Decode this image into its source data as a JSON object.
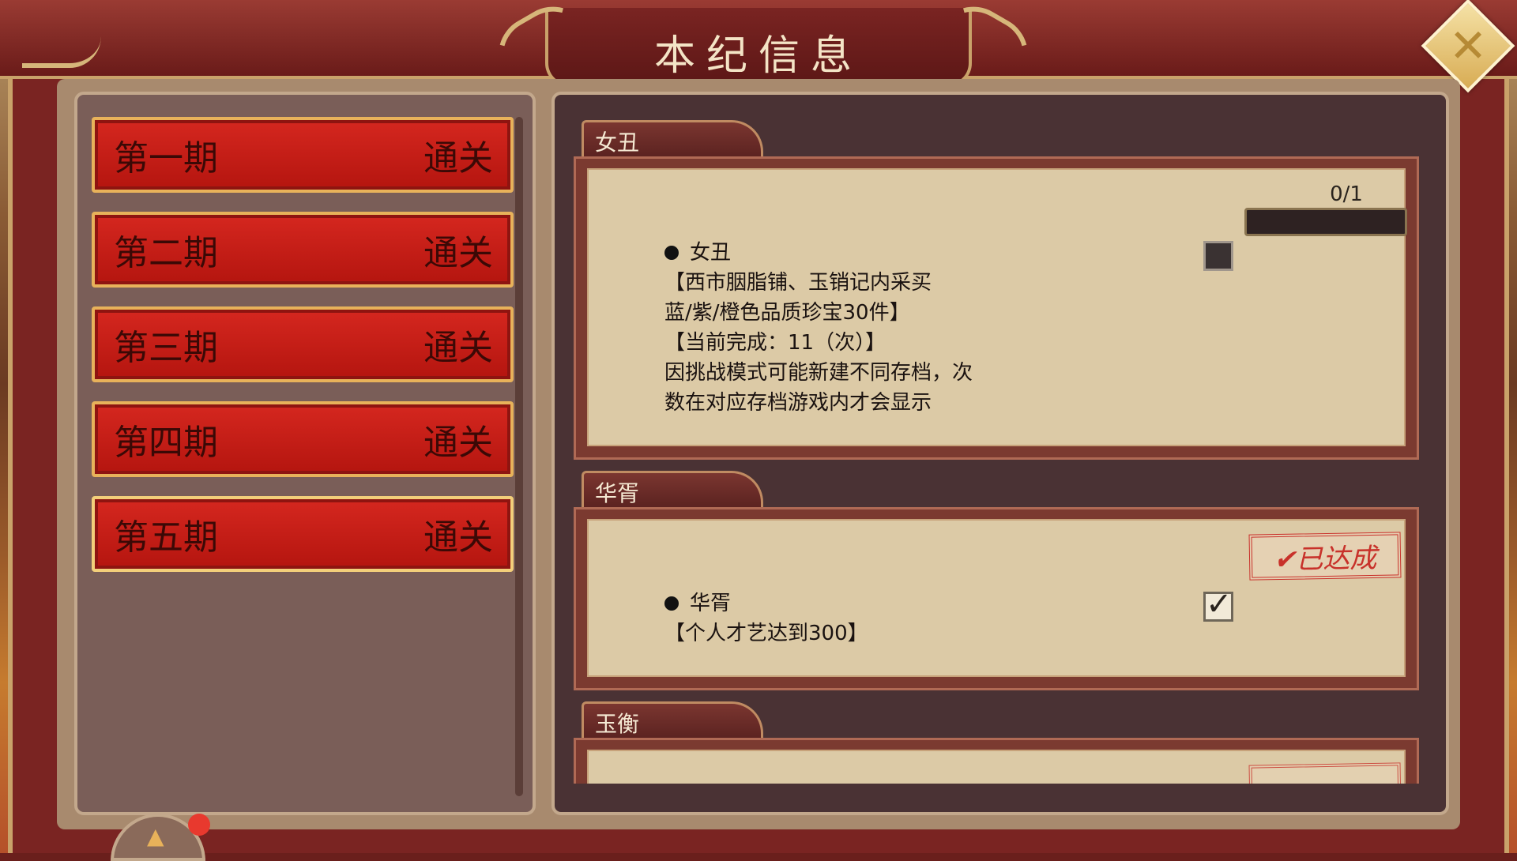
{
  "header": {
    "title": "本纪信息",
    "close_icon": "close-icon"
  },
  "stages": [
    {
      "label": "第一期",
      "status": "通关"
    },
    {
      "label": "第二期",
      "status": "通关"
    },
    {
      "label": "第三期",
      "status": "通关"
    },
    {
      "label": "第四期",
      "status": "通关"
    },
    {
      "label": "第五期",
      "status": "通关"
    }
  ],
  "achievements": [
    {
      "tab": "女丑",
      "progress": "0/1",
      "progress_fraction": 0,
      "title": "女丑",
      "desc": "【西市胭脂铺、玉销记内采买\n蓝/紫/橙色品质珍宝30件】\n【当前完成：11（次）】\n 因挑战模式可能新建不同存档，次\n数在对应存档游戏内才会显示",
      "completed": false
    },
    {
      "tab": "华胥",
      "stamp": "✔已达成",
      "title": "华胥",
      "desc": "【个人才艺达到300】",
      "completed": true
    },
    {
      "tab": "玉衡"
    }
  ],
  "colors": {
    "stage_red": "#c81d17",
    "gold": "#e8b25a",
    "paper": "#dccaa6"
  }
}
